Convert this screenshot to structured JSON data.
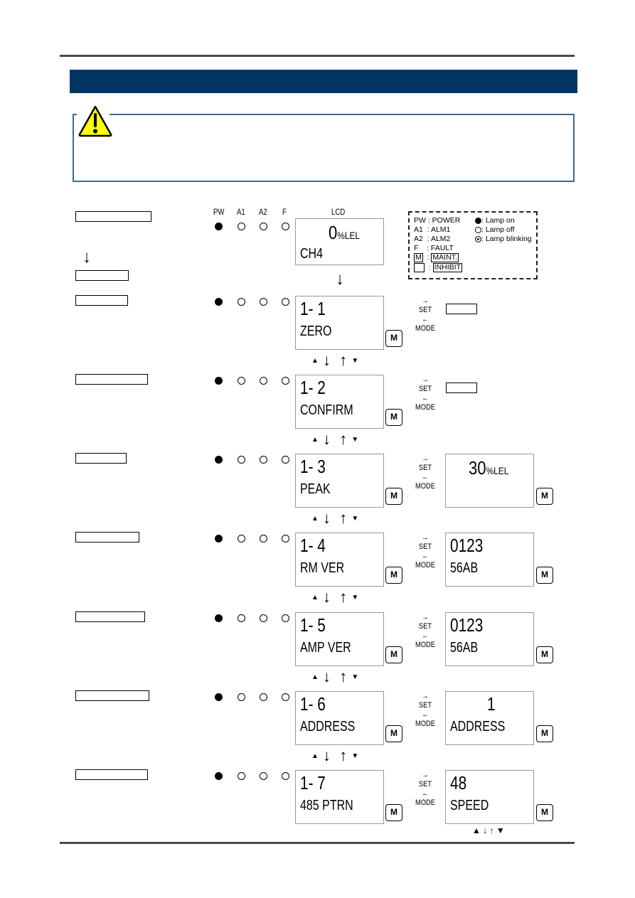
{
  "header": {
    "title": ""
  },
  "caution": {
    "icon": "warning-triangle-icon",
    "text": ""
  },
  "lamp_headers": [
    "PW",
    "A1",
    "A2",
    "F"
  ],
  "lcd_header": "LCD",
  "legend": {
    "lamps": [
      {
        "code": "PW",
        "name": ": POWER"
      },
      {
        "code": "A1",
        "name": ": ALM1"
      },
      {
        "code": "A2",
        "name": ": ALM2"
      },
      {
        "code": "F",
        "name": ": FAULT"
      },
      {
        "code": "M",
        "name": ": ",
        "boxed": "MAINT."
      },
      {
        "code": "",
        "name": ": ",
        "boxed": "INHIBIT"
      }
    ],
    "states": [
      ": Lamp on",
      ": Lamp off",
      ": Lamp blinking"
    ]
  },
  "nav": {
    "set": "SET",
    "mode": "MODE",
    "m_key": "M",
    "right_arrow": "→",
    "left_arrow": "←",
    "down": "↓",
    "up": "↑",
    "tri_up": "▲",
    "tri_down": "▼"
  },
  "initial": {
    "lcd_line1": "0",
    "lcd_unit": "%LEL",
    "lcd_line2": "CH4",
    "lamps": [
      "on",
      "off",
      "off",
      "off"
    ]
  },
  "menu": [
    {
      "lcd_line1": "1- 1",
      "lcd_line2": "ZERO",
      "lamps": [
        "on",
        "off",
        "off",
        "off"
      ],
      "detail": null
    },
    {
      "lcd_line1": "1- 2",
      "lcd_line2": "CONFIRM",
      "lamps": [
        "on",
        "off",
        "off",
        "off"
      ],
      "detail": null
    },
    {
      "lcd_line1": "1- 3",
      "lcd_line2": "PEAK",
      "lamps": [
        "on",
        "off",
        "off",
        "off"
      ],
      "detail": {
        "line1": "30",
        "unit": "%LEL",
        "line2": ""
      }
    },
    {
      "lcd_line1": "1- 4",
      "lcd_line2": "RM VER",
      "lamps": [
        "on",
        "off",
        "off",
        "off"
      ],
      "detail": {
        "line1": "0123",
        "unit": "",
        "line2": "56AB"
      }
    },
    {
      "lcd_line1": "1- 5",
      "lcd_line2": "AMP VER",
      "lamps": [
        "on",
        "off",
        "off",
        "off"
      ],
      "detail": {
        "line1": "0123",
        "unit": "",
        "line2": "56AB"
      }
    },
    {
      "lcd_line1": "1- 6",
      "lcd_line2": "ADDRESS",
      "lamps": [
        "on",
        "off",
        "off",
        "off"
      ],
      "detail": {
        "line1": "1",
        "unit": "",
        "line2": "ADDRESS"
      }
    },
    {
      "lcd_line1": "1- 7",
      "lcd_line2": "485 PTRN",
      "lamps": [
        "on",
        "off",
        "off",
        "off"
      ],
      "detail": {
        "line1": "48",
        "unit": "",
        "line2": "SPEED"
      }
    }
  ]
}
